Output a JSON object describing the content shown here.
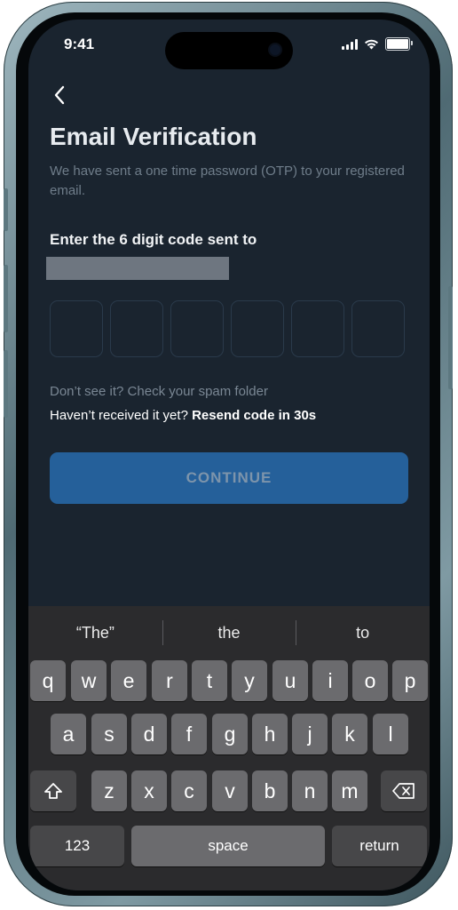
{
  "status_bar": {
    "time": "9:41"
  },
  "screen": {
    "title": "Email Verification",
    "subtitle": "We have sent a one time password (OTP) to your registered email.",
    "enter_label": "Enter the 6 digit code sent to",
    "otp_digits": [
      "",
      "",
      "",
      "",
      "",
      ""
    ],
    "spam_hint": "Don’t see it? Check your spam folder",
    "resend_prefix": "Haven’t received it yet? ",
    "resend_link": "Resend code in 30s",
    "continue_label": "CONTINUE"
  },
  "keyboard": {
    "suggestions": [
      "“The”",
      "the",
      "to"
    ],
    "row1": [
      "q",
      "w",
      "e",
      "r",
      "t",
      "y",
      "u",
      "i",
      "o",
      "p"
    ],
    "row2": [
      "a",
      "s",
      "d",
      "f",
      "g",
      "h",
      "j",
      "k",
      "l"
    ],
    "row3": [
      "z",
      "x",
      "c",
      "v",
      "b",
      "n",
      "m"
    ],
    "numbers_label": "123",
    "space_label": "space",
    "return_label": "return"
  },
  "colors": {
    "background": "#1a242f",
    "accent": "#25609a",
    "keyboard": "#2b2b2d"
  }
}
